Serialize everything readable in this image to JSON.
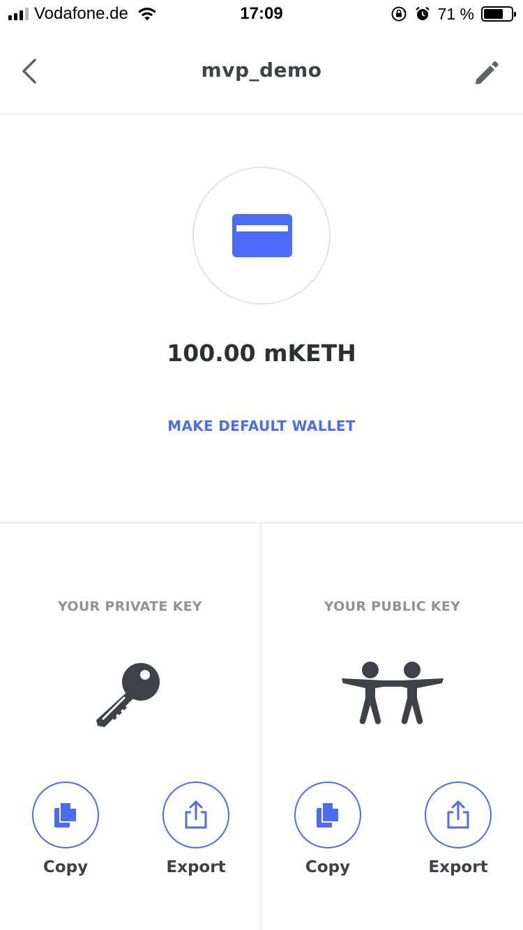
{
  "status_bar": {
    "carrier": "Vodafone.de",
    "time": "17:09",
    "battery_percent": "71 %",
    "battery_level": 0.71,
    "icons": [
      "signal-icon",
      "wifi-icon",
      "orientation-lock-icon",
      "alarm-icon",
      "battery-icon"
    ]
  },
  "nav": {
    "title": "mvp_demo",
    "back_icon": "chevron-left-icon",
    "edit_icon": "pencil-icon"
  },
  "wallet": {
    "icon": "credit-card-icon",
    "balance": "100.00 mKETH",
    "make_default_label": "MAKE DEFAULT WALLET"
  },
  "private_key": {
    "title": "YOUR PRIVATE KEY",
    "icon": "key-icon",
    "copy_label": "Copy",
    "export_label": "Export"
  },
  "public_key": {
    "title": "YOUR PUBLIC KEY",
    "icon": "people-icon",
    "copy_label": "Copy",
    "export_label": "Export"
  },
  "colors": {
    "accent": "#4a6cf7",
    "text_dark": "#2b2f36",
    "text_muted": "#8e939b",
    "divider": "#ececec",
    "icon_dark": "#3d4148"
  }
}
